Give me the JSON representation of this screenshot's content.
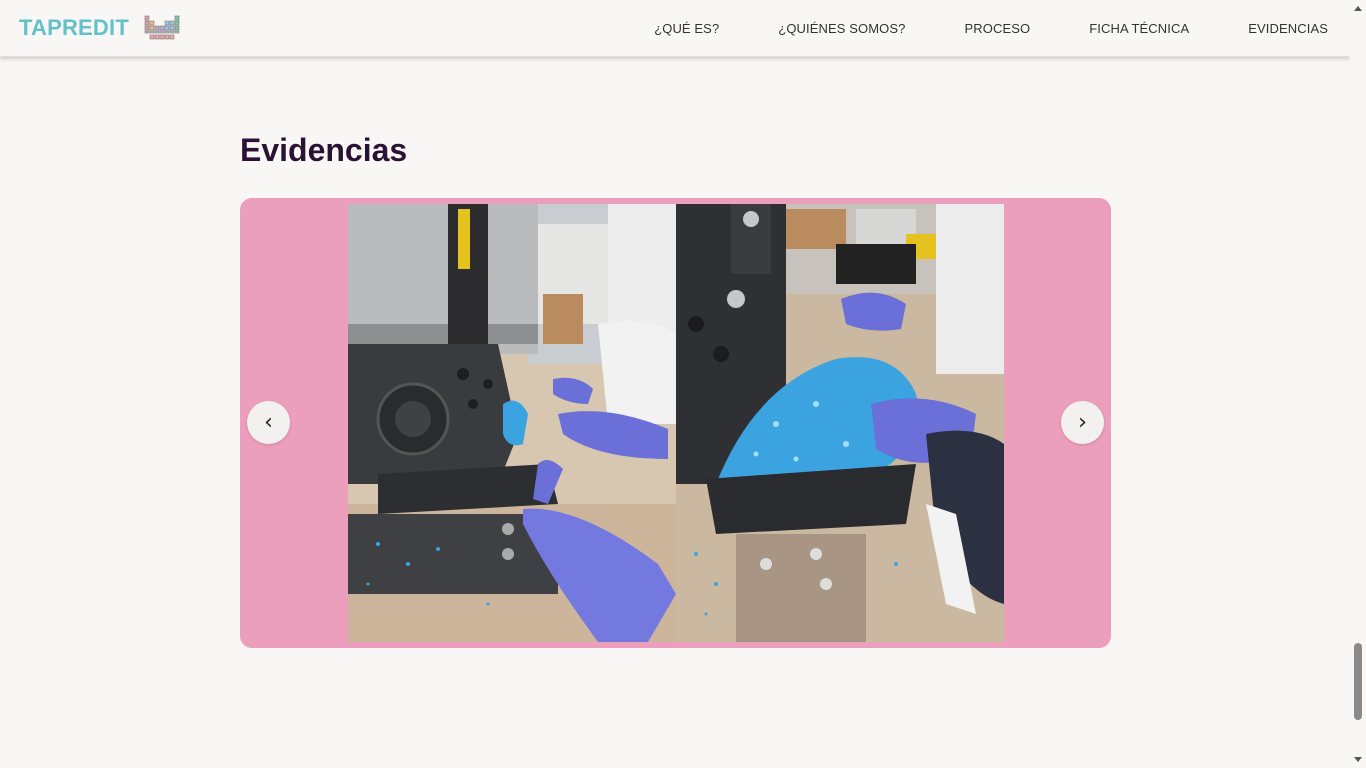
{
  "header": {
    "brand": "TAPREDIT",
    "brand_icon": "periodic-table-icon",
    "nav": [
      {
        "label": "¿QUÉ ES?"
      },
      {
        "label": "¿QUIÉNES SOMOS?"
      },
      {
        "label": "PROCESO"
      },
      {
        "label": "FICHA TÉCNICA"
      },
      {
        "label": "EVIDENCIAS"
      }
    ]
  },
  "section": {
    "title": "Evidencias"
  },
  "carousel": {
    "prev_symbol": "‹",
    "next_symbol": "›",
    "background": "#ec9fbc",
    "images": [
      {
        "icon": "shredder-machine-photo"
      },
      {
        "icon": "blue-plastic-shreds-photo"
      }
    ]
  },
  "colors": {
    "brand": "#62c2c8",
    "title": "#2b1235",
    "glove": "#6b6fd8",
    "shreds": "#3aa3e0"
  }
}
